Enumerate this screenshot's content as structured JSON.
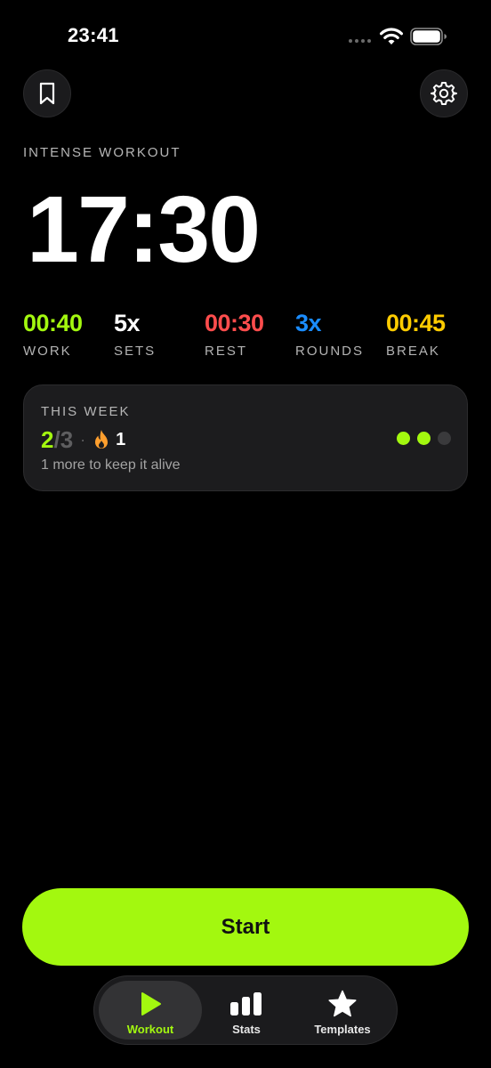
{
  "status_bar": {
    "time": "23:41"
  },
  "header": {
    "workout_name": "INTENSE WORKOUT",
    "total_time": "17:30"
  },
  "stats": [
    {
      "value": "00:40",
      "label": "WORK",
      "color": "#a3f80f"
    },
    {
      "value": "5x",
      "label": "SETS",
      "color": "#ffffff"
    },
    {
      "value": "00:30",
      "label": "REST",
      "color": "#ff4d4d"
    },
    {
      "value": "3x",
      "label": "ROUNDS",
      "color": "#1a8cff"
    },
    {
      "value": "00:45",
      "label": "BREAK",
      "color": "#ffcc00"
    }
  ],
  "week_card": {
    "title": "THIS WEEK",
    "done": "2",
    "total": "/3",
    "separator": "·",
    "streak": "1",
    "subtitle": "1 more to keep it alive",
    "dots": [
      true,
      true,
      false
    ]
  },
  "start_button": {
    "label": "Start"
  },
  "tab_bar": {
    "tabs": [
      {
        "label": "Workout",
        "icon": "play-icon",
        "active": true
      },
      {
        "label": "Stats",
        "icon": "bar-chart-icon",
        "active": false
      },
      {
        "label": "Templates",
        "icon": "star-icon",
        "active": false
      }
    ]
  },
  "colors": {
    "accent": "#a3f80f",
    "card_bg": "#1c1c1e"
  }
}
